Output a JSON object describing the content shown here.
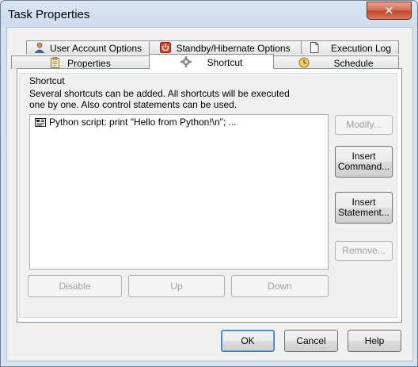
{
  "window": {
    "title": "Task Properties"
  },
  "tabs_row1": [
    {
      "label": "User Account Options",
      "icon": "user-icon"
    },
    {
      "label": "Standby/Hibernate Options",
      "icon": "power-icon"
    },
    {
      "label": "Execution Log",
      "icon": "document-icon"
    }
  ],
  "tabs_row2": [
    {
      "label": "Properties",
      "icon": "properties-icon"
    },
    {
      "label": "Shortcut",
      "icon": "gear-icon",
      "active": true
    },
    {
      "label": "Schedule",
      "icon": "clock-icon"
    }
  ],
  "shortcut": {
    "group_title": "Shortcut",
    "description": "Several shortcuts can be added. All shortcuts will be executed one by one. Also control statements can be used.",
    "items": [
      {
        "text": "Python script: print \"Hello from Python!\\n\"; ...",
        "icon": "script-icon"
      }
    ]
  },
  "side_buttons": {
    "modify": "Modify...",
    "insert_command": [
      "Insert",
      "Command..."
    ],
    "insert_statement": [
      "Insert",
      "Statement..."
    ],
    "remove": "Remove..."
  },
  "bottom_buttons": {
    "disable": "Disable",
    "up": "Up",
    "down": "Down"
  },
  "dialog_buttons": {
    "ok": "OK",
    "cancel": "Cancel",
    "help": "Help"
  }
}
